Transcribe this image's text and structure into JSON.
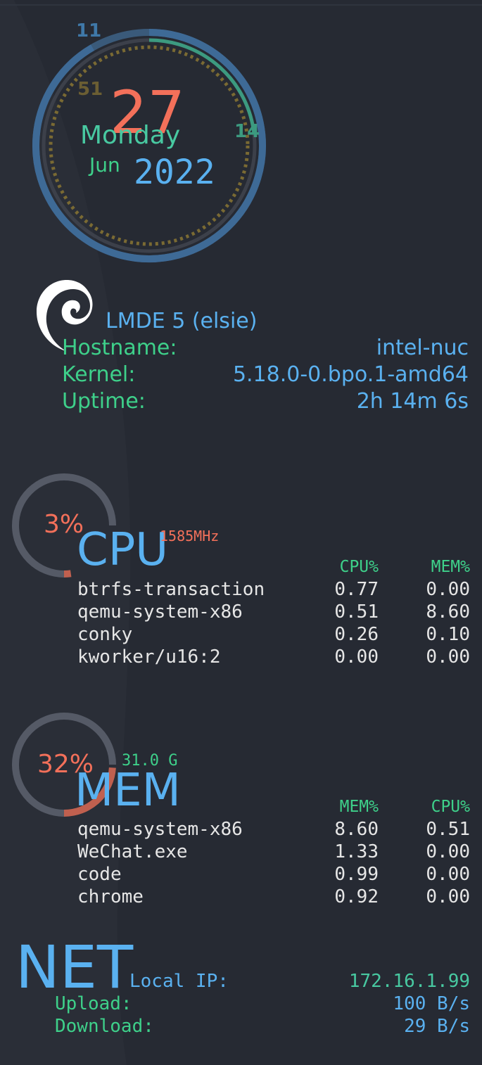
{
  "colors": {
    "background": "#262a33",
    "blue": "#5ab1f0",
    "green": "#3ed08a",
    "teal": "#48c9a1",
    "coral": "#f3705a",
    "gauge_track": "#555a66",
    "text": "#e6e6e6"
  },
  "clock": {
    "hour": "11",
    "minute": "51",
    "second": "14",
    "day": "27",
    "weekday": "Monday",
    "month": "Jun",
    "year": "2022"
  },
  "system": {
    "logo_icon": "debian-swirl-icon",
    "distro": "LMDE 5 (elsie)",
    "rows": [
      {
        "label": "Hostname:",
        "value": "intel-nuc"
      },
      {
        "label": "Kernel:",
        "value": "5.18.0-0.bpo.1-amd64"
      },
      {
        "label": "Uptime:",
        "value": "2h 14m 6s"
      }
    ]
  },
  "cpu": {
    "percent": "3%",
    "level": 0.03,
    "title": "CPU",
    "frequency": "1585MHz",
    "columns": [
      "CPU%",
      "MEM%"
    ],
    "processes": [
      {
        "name": "btrfs-transaction",
        "cpu": "0.77",
        "mem": "0.00"
      },
      {
        "name": "qemu-system-x86",
        "cpu": "0.51",
        "mem": "8.60"
      },
      {
        "name": "conky",
        "cpu": "0.26",
        "mem": "0.10"
      },
      {
        "name": "kworker/u16:2",
        "cpu": "0.00",
        "mem": "0.00"
      }
    ]
  },
  "memory": {
    "percent": "32%",
    "level": 0.32,
    "title": "MEM",
    "total": "31.0 G",
    "columns": [
      "MEM%",
      "CPU%"
    ],
    "processes": [
      {
        "name": "qemu-system-x86",
        "mem": "8.60",
        "cpu": "0.51"
      },
      {
        "name": "WeChat.exe",
        "mem": "1.33",
        "cpu": "0.00"
      },
      {
        "name": "code",
        "mem": "0.99",
        "cpu": "0.00"
      },
      {
        "name": "chrome",
        "mem": "0.92",
        "cpu": "0.00"
      }
    ]
  },
  "network": {
    "title": "NET",
    "local_ip_label": "Local IP:",
    "local_ip": "172.16.1.99",
    "upload_label": "Upload:",
    "upload": "100 B/s",
    "download_label": "Download:",
    "download": "29 B/s"
  }
}
